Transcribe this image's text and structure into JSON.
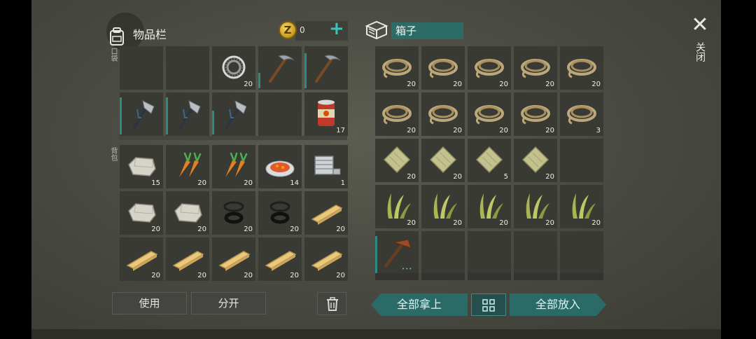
{
  "inventory": {
    "title": "物品栏",
    "coin_symbol": "Z",
    "coins": "0",
    "pocket_label": "口袋",
    "backpack_label": "背包",
    "pocket_slots": [
      {
        "item": "",
        "qty": ""
      },
      {
        "item": "",
        "qty": ""
      },
      {
        "item": "bearing-icon",
        "qty": "20"
      },
      {
        "item": "pickaxe-icon",
        "qty": "",
        "wear": 0.4
      },
      {
        "item": "pickaxe-icon",
        "qty": "",
        "wear": 0.9
      },
      {
        "item": "hatchet-icon",
        "qty": "",
        "wear": 0.95
      },
      {
        "item": "hatchet-icon",
        "qty": "",
        "wear": 0.95
      },
      {
        "item": "hatchet-icon",
        "qty": "",
        "wear": 0.6
      },
      {
        "item": "",
        "qty": ""
      },
      {
        "item": "canned-food-icon",
        "qty": "17"
      }
    ],
    "backpack_slots": [
      {
        "item": "stone-icon",
        "qty": "15"
      },
      {
        "item": "carrot-icon",
        "qty": "20"
      },
      {
        "item": "carrot-icon",
        "qty": "20"
      },
      {
        "item": "cooked-vegetables-icon",
        "qty": "14"
      },
      {
        "item": "engine-part-icon",
        "qty": "1"
      },
      {
        "item": "stone-icon",
        "qty": "20"
      },
      {
        "item": "stone-icon",
        "qty": "20"
      },
      {
        "item": "rubber-ring-icon",
        "qty": "20"
      },
      {
        "item": "rubber-ring-icon",
        "qty": "20"
      },
      {
        "item": "plank-icon",
        "qty": "20"
      },
      {
        "item": "plank-icon",
        "qty": "20"
      },
      {
        "item": "plank-icon",
        "qty": "20"
      },
      {
        "item": "plank-icon",
        "qty": "20"
      },
      {
        "item": "plank-icon",
        "qty": "20"
      },
      {
        "item": "plank-icon",
        "qty": "20"
      }
    ],
    "use_button": "使用",
    "split_button": "分开"
  },
  "box": {
    "title": "箱子",
    "slots": [
      {
        "item": "rope-icon",
        "qty": "20"
      },
      {
        "item": "rope-icon",
        "qty": "20"
      },
      {
        "item": "rope-icon",
        "qty": "20"
      },
      {
        "item": "rope-icon",
        "qty": "20"
      },
      {
        "item": "rope-icon",
        "qty": "20"
      },
      {
        "item": "rope-icon",
        "qty": "20"
      },
      {
        "item": "rope-icon",
        "qty": "20"
      },
      {
        "item": "rope-icon",
        "qty": "20"
      },
      {
        "item": "rope-icon",
        "qty": "20"
      },
      {
        "item": "rope-icon",
        "qty": "3"
      },
      {
        "item": "cloth-icon",
        "qty": "20"
      },
      {
        "item": "cloth-icon",
        "qty": "20"
      },
      {
        "item": "cloth-icon",
        "qty": "5"
      },
      {
        "item": "cloth-icon",
        "qty": "20"
      },
      {
        "item": "",
        "qty": ""
      },
      {
        "item": "plant-fiber-icon",
        "qty": "20"
      },
      {
        "item": "plant-fiber-icon",
        "qty": "20"
      },
      {
        "item": "plant-fiber-icon",
        "qty": "20"
      },
      {
        "item": "plant-fiber-icon",
        "qty": "20"
      },
      {
        "item": "plant-fiber-icon",
        "qty": "20"
      },
      {
        "item": "primitive-pickaxe-icon",
        "qty": "",
        "wear": 0.95,
        "dots": "•••"
      },
      {
        "item": "",
        "qty": ""
      },
      {
        "item": "",
        "qty": ""
      },
      {
        "item": "",
        "qty": ""
      },
      {
        "item": "",
        "qty": ""
      }
    ],
    "take_all_button": "全部拿上",
    "put_all_button": "全部放入"
  },
  "close_label": "关闭",
  "colors": {
    "accent": "#2a6b67",
    "plus": "#39c5c0",
    "wear": "#2c8a85"
  }
}
